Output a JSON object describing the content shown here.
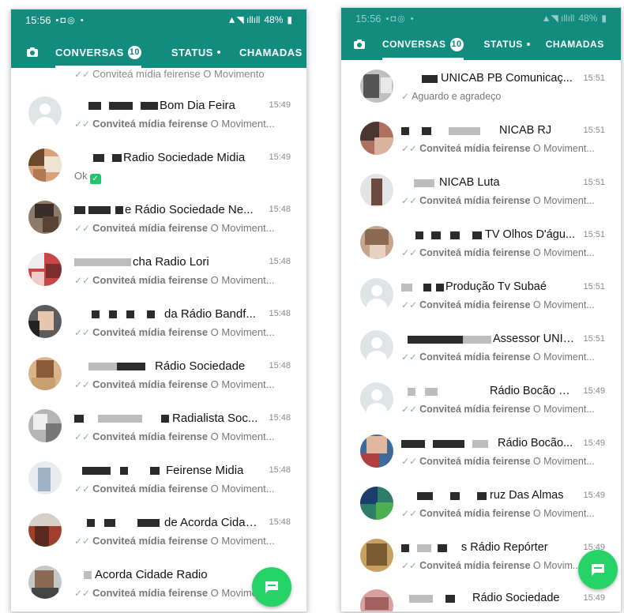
{
  "tabs": {
    "conversas": "CONVERSAS",
    "status": "STATUS",
    "chamadas": "CHAMADAS",
    "unread_count": "10"
  },
  "colors": {
    "header": "#128c7e",
    "accent": "#25d366"
  },
  "left": {
    "status_time": "15:56",
    "battery": "48%",
    "top_partial_preview": "Conviteá mídia feirense O Movimento",
    "chats": [
      {
        "name": "Bom Dia Feira",
        "time": "15:49",
        "preview_bold": "Conviteá mídia feirense",
        "preview_rest": " O Moviment..."
      },
      {
        "name": "Radio Sociedade Midia",
        "time": "15:49",
        "preview_text": "Ok"
      },
      {
        "name": "e Rádio Sociedade Ne...",
        "time": "15:48",
        "preview_bold": "Conviteá mídia feirense",
        "preview_rest": " O Moviment..."
      },
      {
        "name": "cha Radio Lori",
        "time": "15:48",
        "preview_bold": "Conviteá mídia feirense",
        "preview_rest": " O Moviment..."
      },
      {
        "name": "da Rádio Bandf...",
        "time": "15:48",
        "preview_bold": "Conviteá mídia feirense",
        "preview_rest": " O Moviment..."
      },
      {
        "name": "Rádio Sociedade",
        "time": "15:48",
        "preview_bold": "Conviteá mídia feirense",
        "preview_rest": " O Moviment..."
      },
      {
        "name": "Radialista Soc...",
        "time": "15:48",
        "preview_bold": "Conviteá mídia feirense",
        "preview_rest": " O Moviment..."
      },
      {
        "name": "Feirense Midia",
        "time": "15:48",
        "preview_bold": "Conviteá mídia feirense",
        "preview_rest": " O Moviment..."
      },
      {
        "name": "de Acorda Cidad...",
        "time": "15:48",
        "preview_bold": "Conviteá mídia feirense",
        "preview_rest": " O Moviment..."
      },
      {
        "name": "Acorda Cidade Radio",
        "time": "",
        "preview_bold": "Conviteá mídia feirense",
        "preview_rest": " O Moviment..."
      }
    ]
  },
  "right": {
    "status_time": "15:56",
    "battery": "48%",
    "chats": [
      {
        "name": "UNICAB PB Comunicaç...",
        "time": "15:51",
        "preview_text": "Aguardo e agradeço"
      },
      {
        "name": "NICAB RJ",
        "time": "15:51",
        "preview_bold": "Conviteá mídia feirense",
        "preview_rest": " O Moviment..."
      },
      {
        "name": "NICAB Luta",
        "time": "15:51",
        "preview_bold": "Conviteá mídia feirense",
        "preview_rest": " O Moviment..."
      },
      {
        "name": "TV Olhos D'águ...",
        "time": "15:51",
        "preview_bold": "Conviteá mídia feirense",
        "preview_rest": " O Moviment..."
      },
      {
        "name": "Produção Tv Subaé",
        "time": "15:51",
        "preview_bold": "Conviteá mídia feirense",
        "preview_rest": " O Moviment..."
      },
      {
        "name": "Assessor UNICAB",
        "time": "15:51",
        "preview_bold": "Conviteá mídia feirense",
        "preview_rest": " O Moviment..."
      },
      {
        "name": "Rádio Bocão News",
        "time": "15:49",
        "preview_bold": "Conviteá mídia feirense",
        "preview_rest": " O Moviment..."
      },
      {
        "name": "Rádio Bocão...",
        "time": "15:49",
        "preview_bold": "Conviteá mídia feirense",
        "preview_rest": " O Moviment..."
      },
      {
        "name": "ruz Das Almas",
        "time": "15:49",
        "preview_bold": "Conviteá mídia feirense",
        "preview_rest": " O Moviment..."
      },
      {
        "name": "s Rádio Repórter",
        "time": "15:49",
        "preview_bold": "Conviteá mídia feirense",
        "preview_rest": " O Movim..."
      },
      {
        "name": "Rádio Sociedade",
        "time": "15:49",
        "preview_bold": "",
        "preview_rest": ""
      }
    ]
  }
}
